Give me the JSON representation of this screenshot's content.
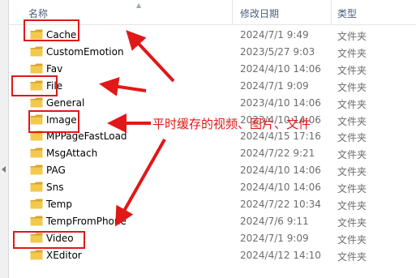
{
  "header": {
    "name_label": "名称",
    "date_label": "修改日期",
    "type_label": "类型"
  },
  "rows": [
    {
      "name": "Cache",
      "date": "2024/7/1 9:49",
      "type": "文件夹",
      "highlighted": true
    },
    {
      "name": "CustomEmotion",
      "date": "2023/5/27 9:03",
      "type": "文件夹",
      "highlighted": false
    },
    {
      "name": "Fav",
      "date": "2024/4/10 14:06",
      "type": "文件夹",
      "highlighted": false
    },
    {
      "name": "File",
      "date": "2024/7/1 9:09",
      "type": "文件夹",
      "highlighted": true
    },
    {
      "name": "General",
      "date": "2023/4/10 14:06",
      "type": "文件夹",
      "highlighted": false
    },
    {
      "name": "Image",
      "date": "2023/4/10 14:06",
      "type": "文件夹",
      "highlighted": true
    },
    {
      "name": "MPPageFastLoad",
      "date": "2024/4/15 17:16",
      "type": "文件夹",
      "highlighted": false
    },
    {
      "name": "MsgAttach",
      "date": "2024/7/22 9:21",
      "type": "文件夹",
      "highlighted": false
    },
    {
      "name": "PAG",
      "date": "2024/4/10 14:06",
      "type": "文件夹",
      "highlighted": false
    },
    {
      "name": "Sns",
      "date": "2024/4/10 14:06",
      "type": "文件夹",
      "highlighted": false
    },
    {
      "name": "Temp",
      "date": "2024/7/22 10:34",
      "type": "文件夹",
      "highlighted": false
    },
    {
      "name": "TempFromPhone",
      "date": "2024/7/6 9:11",
      "type": "文件夹",
      "highlighted": false
    },
    {
      "name": "Video",
      "date": "2024/7/1 9:09",
      "type": "文件夹",
      "highlighted": true
    },
    {
      "name": "XEditor",
      "date": "2024/4/12 14:10",
      "type": "文件夹",
      "highlighted": false
    }
  ],
  "annotation": {
    "text": "平时缓存的视频、图片、文件",
    "color": "#e01818"
  },
  "colors": {
    "folder_yellow": "#f2c94c",
    "folder_dark": "#d9a52b",
    "header_text": "#4c607a"
  },
  "icons": {
    "folder": "folder-icon",
    "sort": "sort-caret-icon",
    "arrow": "red-arrow"
  }
}
